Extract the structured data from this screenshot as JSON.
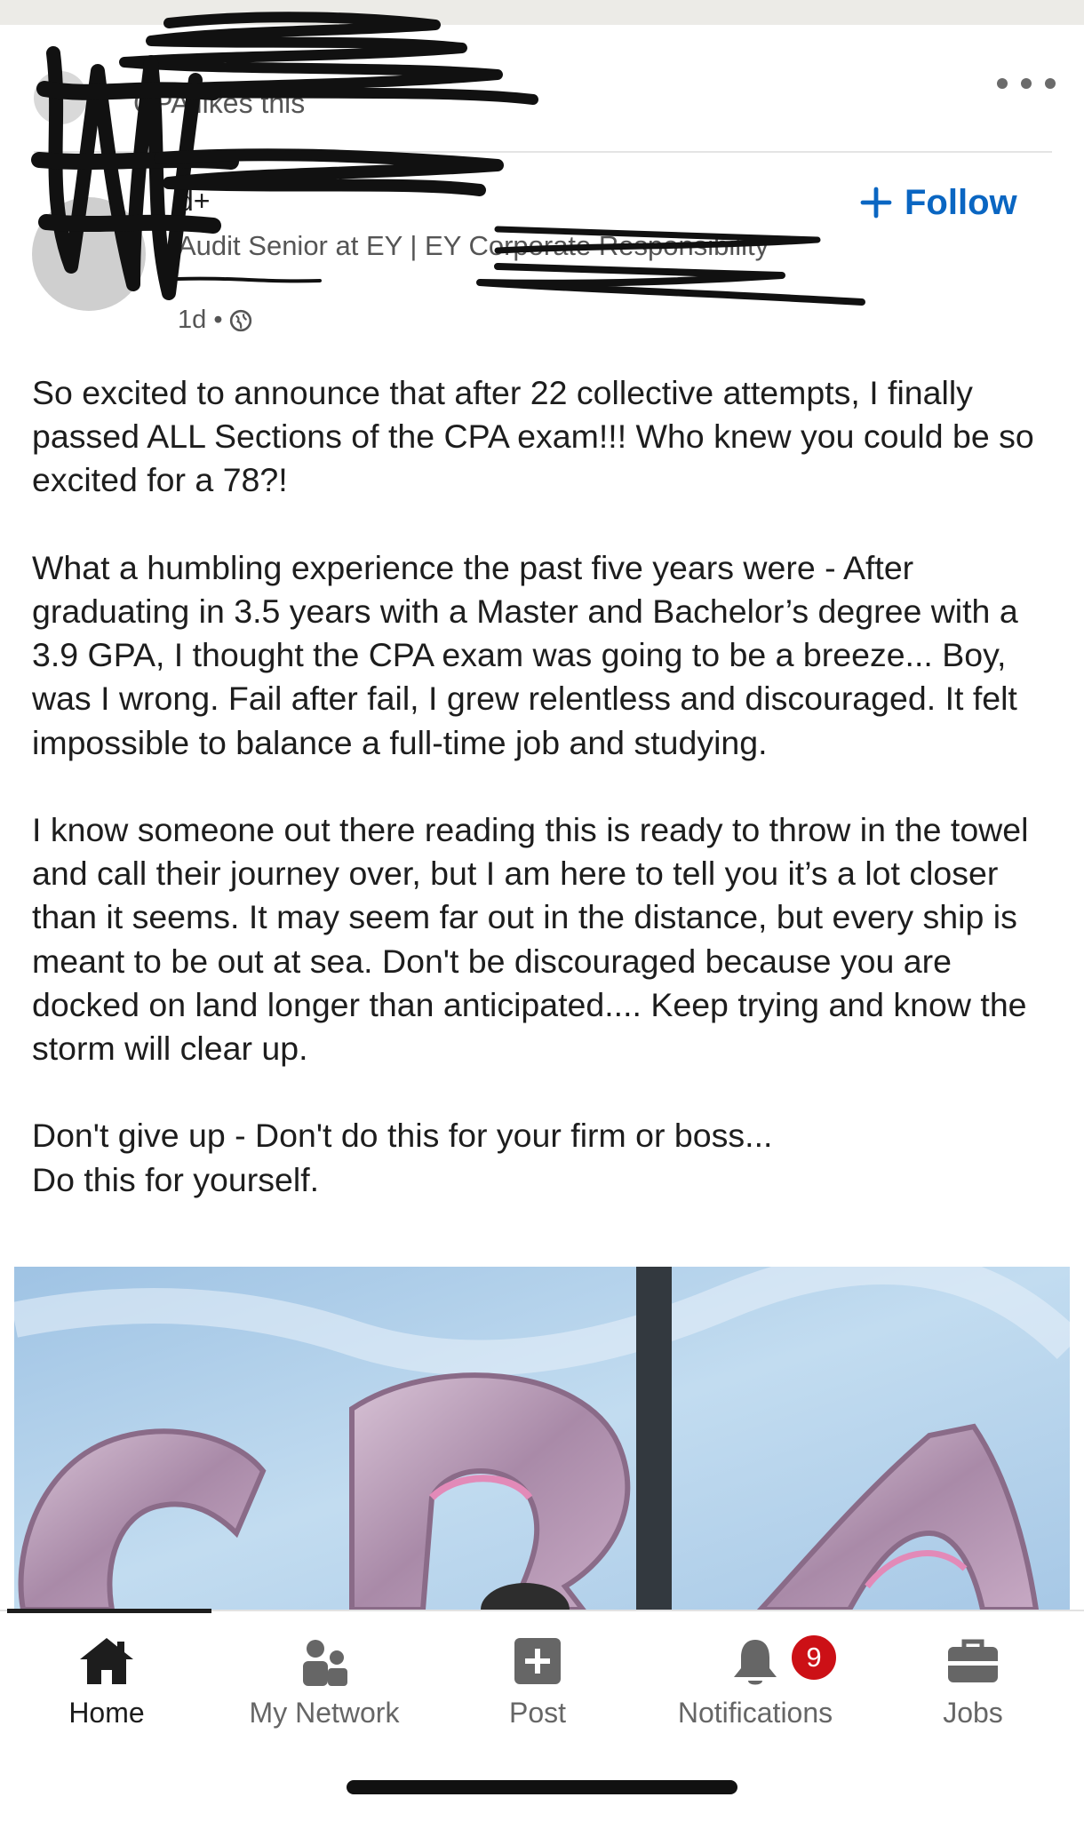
{
  "social_proof": {
    "text": "CPA likes this"
  },
  "author": {
    "name": "d+",
    "headline": "Audit Senior at EY | EY Corporate Responsibility",
    "time": "1d •"
  },
  "follow": {
    "label": "Follow"
  },
  "post": {
    "paragraphs": [
      "So excited to announce that after 22 collective attempts, I finally passed ALL Sections of the CPA exam!!! Who knew you could be so excited for a 78?!",
      "What a humbling experience the past five years were - After graduating in 3.5 years with a Master and Bachelor’s degree with a 3.9 GPA, I thought the CPA exam was going to be a breeze... Boy, was I wrong. Fail after fail, I grew relentless and discouraged. It felt impossible to balance a full-time job and studying.",
      "I know someone out there reading this is ready to throw in the towel and call their journey over, but I am here to tell you it’s a lot closer than it seems. It may seem far out in the distance, but every ship is meant to be out at sea. Don't be discouraged because you are docked on land longer than anticipated.... Keep trying and know the storm will clear up.",
      "Don't give up - Don't do this for your firm or boss... Do this for yourself."
    ]
  },
  "image": {
    "letters": [
      "C",
      "P",
      "A"
    ]
  },
  "nav": {
    "home": "Home",
    "network": "My Network",
    "post": "Post",
    "notifications": "Notifications",
    "notifications_badge": "9",
    "jobs": "Jobs"
  },
  "colors": {
    "accent": "#0a66c2",
    "badge": "#cc1016",
    "sky": "#a9c9e6",
    "balloon": "#b89bb4"
  }
}
